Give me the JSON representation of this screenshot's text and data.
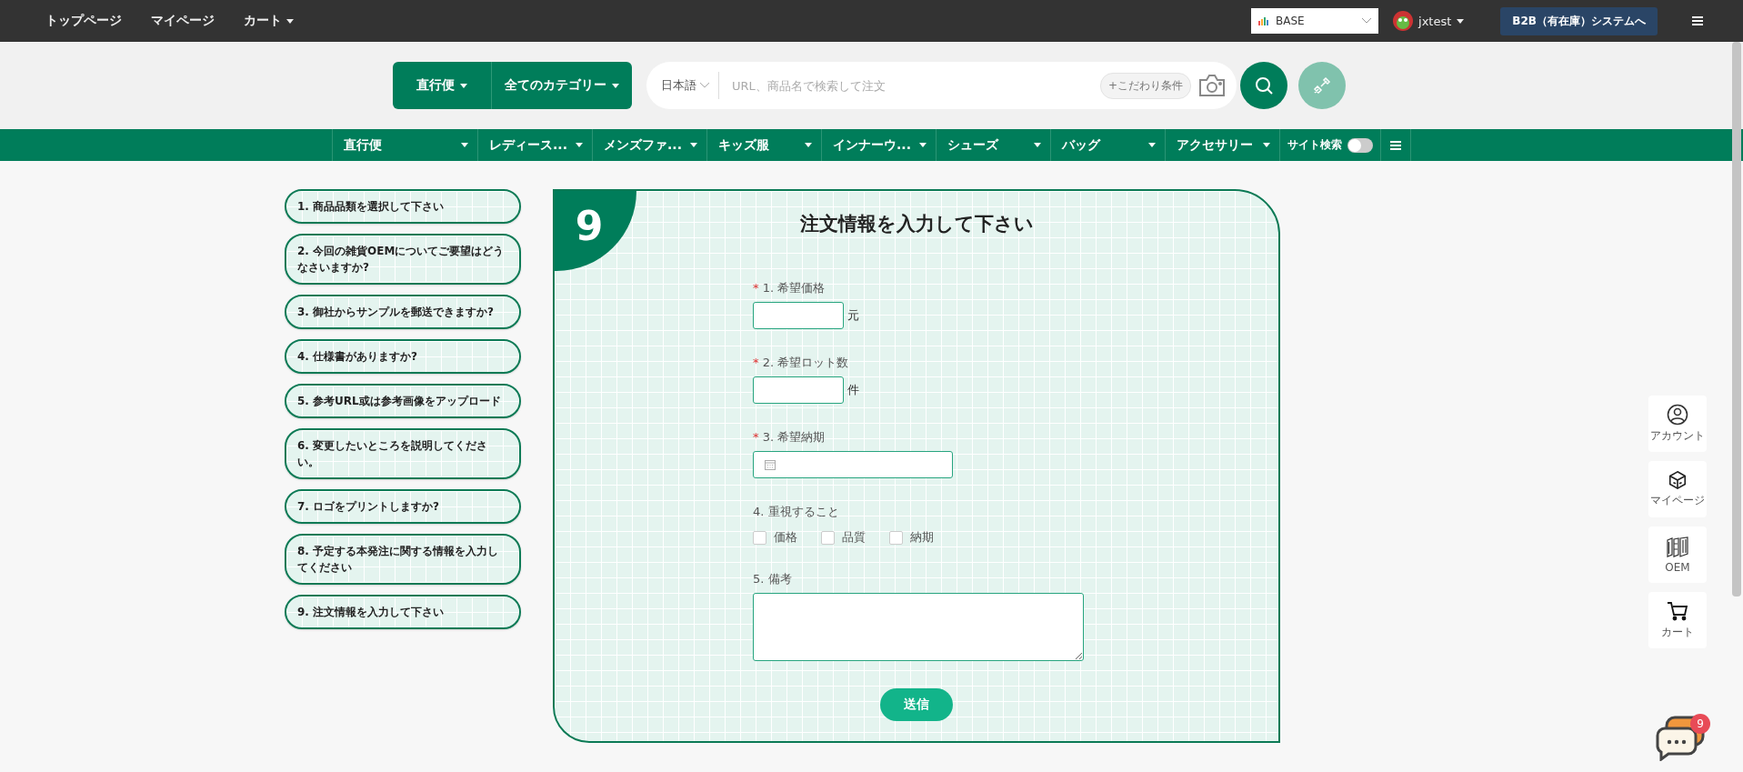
{
  "topbar": {
    "nav": [
      {
        "label": "トップページ",
        "dropdown": false
      },
      {
        "label": "マイページ",
        "dropdown": false
      },
      {
        "label": "カート",
        "dropdown": true
      }
    ],
    "store_select": {
      "value": "BASE"
    },
    "user": {
      "name": "jxtest"
    },
    "b2b_button": "B2B（有在庫）システムへ"
  },
  "search": {
    "mode": "直行便",
    "category": "全てのカテゴリー",
    "language": "日本語",
    "placeholder": "URL、商品名で検索して注文",
    "filter_button": "+こだわり条件"
  },
  "category_bar": {
    "items": [
      {
        "label": "直行便"
      },
      {
        "label": "レディース..."
      },
      {
        "label": "メンズファ..."
      },
      {
        "label": "キッズ服"
      },
      {
        "label": "インナーウ..."
      },
      {
        "label": "シューズ"
      },
      {
        "label": "バッグ"
      },
      {
        "label": "アクセサリー"
      }
    ],
    "site_search": {
      "label": "サイト検索",
      "on": false
    }
  },
  "steps": [
    {
      "label": "1. 商品品類を選択して下さい"
    },
    {
      "label": "2. 今回の雑貨OEMについてご要望はどうなさいますか?"
    },
    {
      "label": "3. 御社からサンプルを郵送できますか?"
    },
    {
      "label": "4. 仕様書がありますか?"
    },
    {
      "label": "5. 参考URL或は参考画像をアップロード"
    },
    {
      "label": "6. 変更したいところを説明してください。"
    },
    {
      "label": "7. ロゴをプリントしますか?"
    },
    {
      "label": "8. 予定する本発注に関する情報を入力してください"
    },
    {
      "label": "9. 注文情報を入力して下さい"
    }
  ],
  "form": {
    "step_number": "9",
    "title": "注文情報を入力して下さい",
    "fields": [
      {
        "kind": "text",
        "required_mark": "*",
        "label": "1. 希望価格",
        "unit": "元"
      },
      {
        "kind": "text",
        "required_mark": "*",
        "label": "2. 希望ロット数",
        "unit": "件"
      },
      {
        "kind": "date",
        "required_mark": "*",
        "label": "3. 希望納期"
      },
      {
        "kind": "checkboxes",
        "label": "4. 重視すること",
        "options": [
          {
            "label": "価格",
            "checked": false
          },
          {
            "label": "品質",
            "checked": false
          },
          {
            "label": "納期",
            "checked": false
          }
        ]
      },
      {
        "kind": "textarea",
        "label": "5. 備考"
      }
    ],
    "submit": "送信"
  },
  "side_buttons": [
    {
      "kind": "account",
      "label": "アカウント"
    },
    {
      "kind": "mypage",
      "label": "マイページ"
    },
    {
      "kind": "oem",
      "label": "OEM"
    },
    {
      "kind": "cart",
      "label": "カート"
    }
  ],
  "chat": {
    "badge": "9"
  }
}
